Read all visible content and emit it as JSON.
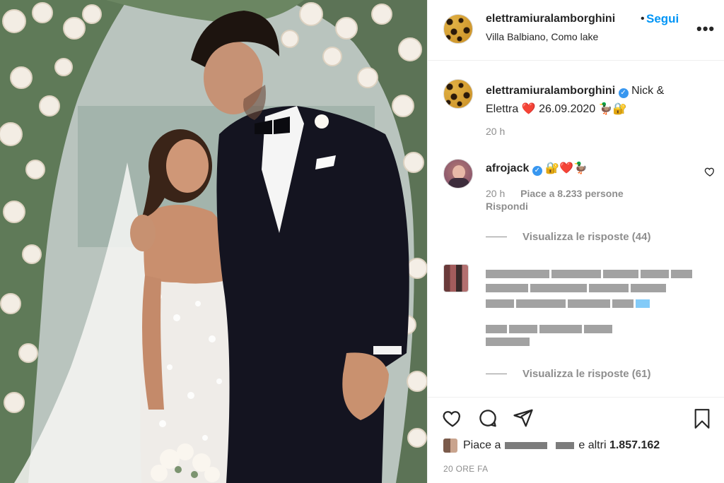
{
  "post": {
    "username": "elettramiuralamborghini",
    "follow_label": "Segui",
    "location": "Villa Balbiano, Como lake",
    "more_icon": "more-options-icon"
  },
  "caption": {
    "username": "elettramiuralamborghini",
    "text_part1": "Nick &",
    "text_part2": "Elettra",
    "heart": "❤️",
    "date": "26.09.2020",
    "emoji_tail": "🦆🔐",
    "time": "20 h"
  },
  "comments": [
    {
      "username": "afrojack",
      "text": "🔐❤️🦆",
      "time": "20 h",
      "likes": "Piace a 8.233 persone",
      "reply": "Rispondi",
      "view_replies": "Visualizza le risposte (44)"
    },
    {
      "view_replies": "Visualizza le risposte (61)"
    }
  ],
  "footer": {
    "likes_prefix": "Piace a",
    "likes_suffix": "e altri",
    "likes_count": "1.857.162",
    "ago": "20 ORE FA"
  },
  "colors": {
    "accent_blue": "#0095f6",
    "verified_blue": "#3897f0",
    "muted_text": "#8e8e8e"
  }
}
